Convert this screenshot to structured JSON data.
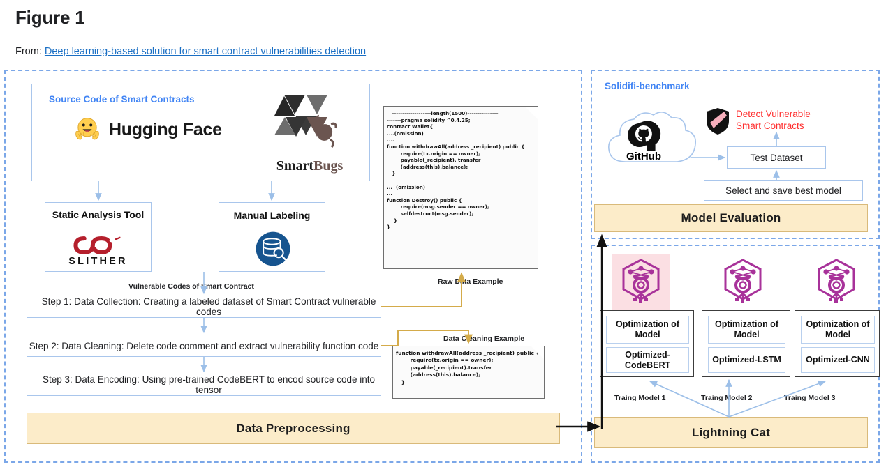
{
  "header": {
    "figure_title": "Figure 1",
    "from_label": "From:",
    "paper_link": "Deep learning-based solution for smart contract vulnerabilities detection"
  },
  "left_panel": {
    "source_box": {
      "heading": "Source Code of Smart Contracts",
      "logos": [
        {
          "name": "hugging-face",
          "text": "Hugging Face",
          "icon": "hugging-face-emoji"
        },
        {
          "name": "smartbugs",
          "text_a": "Smart",
          "text_b": "Bugs",
          "icon": "smartbugs-logo"
        }
      ]
    },
    "tool_boxes": [
      {
        "title": "Static Analysis Tool",
        "logo_word": "SLITHER",
        "icon": "slither-snake-icon"
      },
      {
        "title": "Manual Labeling",
        "icon": "database-search-icon"
      }
    ],
    "connector_label": "Vulnerable Codes of Smart Contract",
    "steps": [
      "Step 1: Data Collection: Creating a labeled dataset of Smart Contract vulnerable codes",
      "Step 2: Data Cleaning: Delete code comment and extract vulnerability function code",
      "Step 3: Data Encoding: Using pre-trained CodeBERT to encod source code into tensor"
    ],
    "raw_example": {
      "label": "Raw Data Example",
      "code": "   -------------------length(1500)---------------\n-------pragma solidity ^0.4.25;\ncontract Wallet{\n....(omission)\n....\nfunction withdrawAll(address _recipient) public {\n        require(tx.origin == owner);\n        payable(_recipient). transfer\n        (address(this).balance);\n   }\n\n...  (omission)\n...\nfunction Destroy() public {\n        require(msg.sender == owner);\n        selfdestruct(msg.sender);\n    }\n}"
    },
    "clean_example": {
      "label": "Data Cleaning Example",
      "code": "function withdrawAll(address _recipient) public {\n        require(tx.origin == owner);\n        payable(_recipient).transfer\n        (address(this).balance);\n   }"
    },
    "footer_bar": "Data Preprocessing"
  },
  "eval_panel": {
    "heading": "Solidifi-benchmark",
    "github_label": "GitHub",
    "detect_text_line1": "Detect Vulnerable",
    "detect_text_line2": "Smart Contracts",
    "test_dataset": "Test Dataset",
    "select_save": "Select and save best model",
    "footer_bar": "Model Evaluation"
  },
  "train_panel": {
    "models": [
      {
        "opt_title": "Optimization of Model",
        "opt_name": "Optimized-CodeBERT",
        "arrow_label": "Traing Model 1",
        "highlighted": true
      },
      {
        "opt_title": "Optimization of Model",
        "opt_name": "Optimized-LSTM",
        "arrow_label": "Traing Model 2",
        "highlighted": false
      },
      {
        "opt_title": "Optimization of Model",
        "opt_name": "Optimized-CNN",
        "arrow_label": "Traing Model 3",
        "highlighted": false
      }
    ],
    "footer_bar": "Lightning Cat"
  },
  "colors": {
    "panel_border": "#7ba7e8",
    "box_border": "#a9c6ec",
    "yellow_fill": "#fcecc9",
    "yellow_border": "#d9ba7a",
    "accent_blue": "#4285f4",
    "link_blue": "#1a6fc4",
    "alert_red": "#ff2d2d",
    "arrow_gold": "#d4ab4a",
    "arrow_blue": "#9cbfe8",
    "nn_purple": "#a8329a",
    "nn_highlight_bg": "#fbdfe3"
  }
}
